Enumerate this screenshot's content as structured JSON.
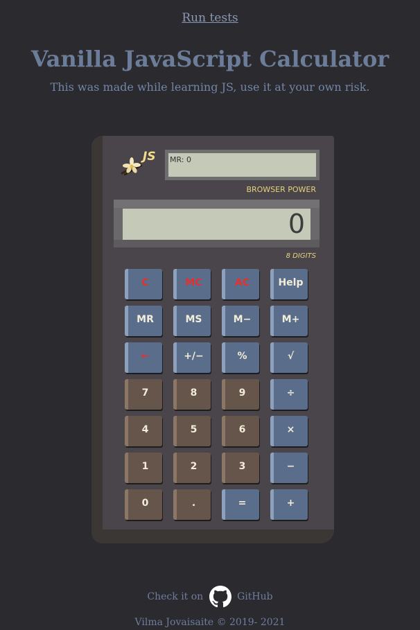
{
  "header": {
    "run_tests_label": "Run tests",
    "title": "Vanilla JavaScript Calculator",
    "subtitle": "This was made while learning JS, use it at your own risk."
  },
  "calculator": {
    "logo_text": "JS",
    "logo_icon": "vanilla-flower-icon",
    "memory_display": "MR: 0",
    "power_label": "BROWSER POWER",
    "display_value": "0",
    "digits_label": "8 DIGITS",
    "colors": {
      "body": "#45413f",
      "screen": "#c4c9b8",
      "blue_key": "#5a6e8c",
      "brown_key": "#66554a",
      "red_text": "#e53030",
      "accent_label": "#e8d37c"
    },
    "keys": [
      [
        {
          "label": "C",
          "style": "blue",
          "red": true
        },
        {
          "label": "MC",
          "style": "blue",
          "red": true
        },
        {
          "label": "AC",
          "style": "blue",
          "red": true
        },
        {
          "label": "Help",
          "style": "blue",
          "red": false
        }
      ],
      [
        {
          "label": "MR",
          "style": "blue",
          "red": false
        },
        {
          "label": "MS",
          "style": "blue",
          "red": false
        },
        {
          "label": "M−",
          "style": "blue",
          "red": false
        },
        {
          "label": "M+",
          "style": "blue",
          "red": false
        }
      ],
      [
        {
          "label": "←",
          "style": "blue",
          "red": true
        },
        {
          "label": "+/−",
          "style": "blue",
          "red": false
        },
        {
          "label": "%",
          "style": "blue",
          "red": false
        },
        {
          "label": "√",
          "style": "blue",
          "red": false
        }
      ],
      [
        {
          "label": "7",
          "style": "brown",
          "red": false
        },
        {
          "label": "8",
          "style": "brown",
          "red": false
        },
        {
          "label": "9",
          "style": "brown",
          "red": false
        },
        {
          "label": "÷",
          "style": "blue",
          "red": false
        }
      ],
      [
        {
          "label": "4",
          "style": "brown",
          "red": false
        },
        {
          "label": "5",
          "style": "brown",
          "red": false
        },
        {
          "label": "6",
          "style": "brown",
          "red": false
        },
        {
          "label": "×",
          "style": "blue",
          "red": false
        }
      ],
      [
        {
          "label": "1",
          "style": "brown",
          "red": false
        },
        {
          "label": "2",
          "style": "brown",
          "red": false
        },
        {
          "label": "3",
          "style": "brown",
          "red": false
        },
        {
          "label": "−",
          "style": "blue",
          "red": false
        }
      ],
      [
        {
          "label": "0",
          "style": "brown",
          "red": false
        },
        {
          "label": ".",
          "style": "brown",
          "red": false
        },
        {
          "label": "=",
          "style": "blue",
          "red": false
        },
        {
          "label": "+",
          "style": "blue",
          "red": false
        }
      ]
    ]
  },
  "footer": {
    "check_prefix": "Check it on",
    "github_label": "GitHub",
    "github_icon": "github-icon",
    "copyright": "Vilma Jovaisaite © 2019- 2021"
  }
}
